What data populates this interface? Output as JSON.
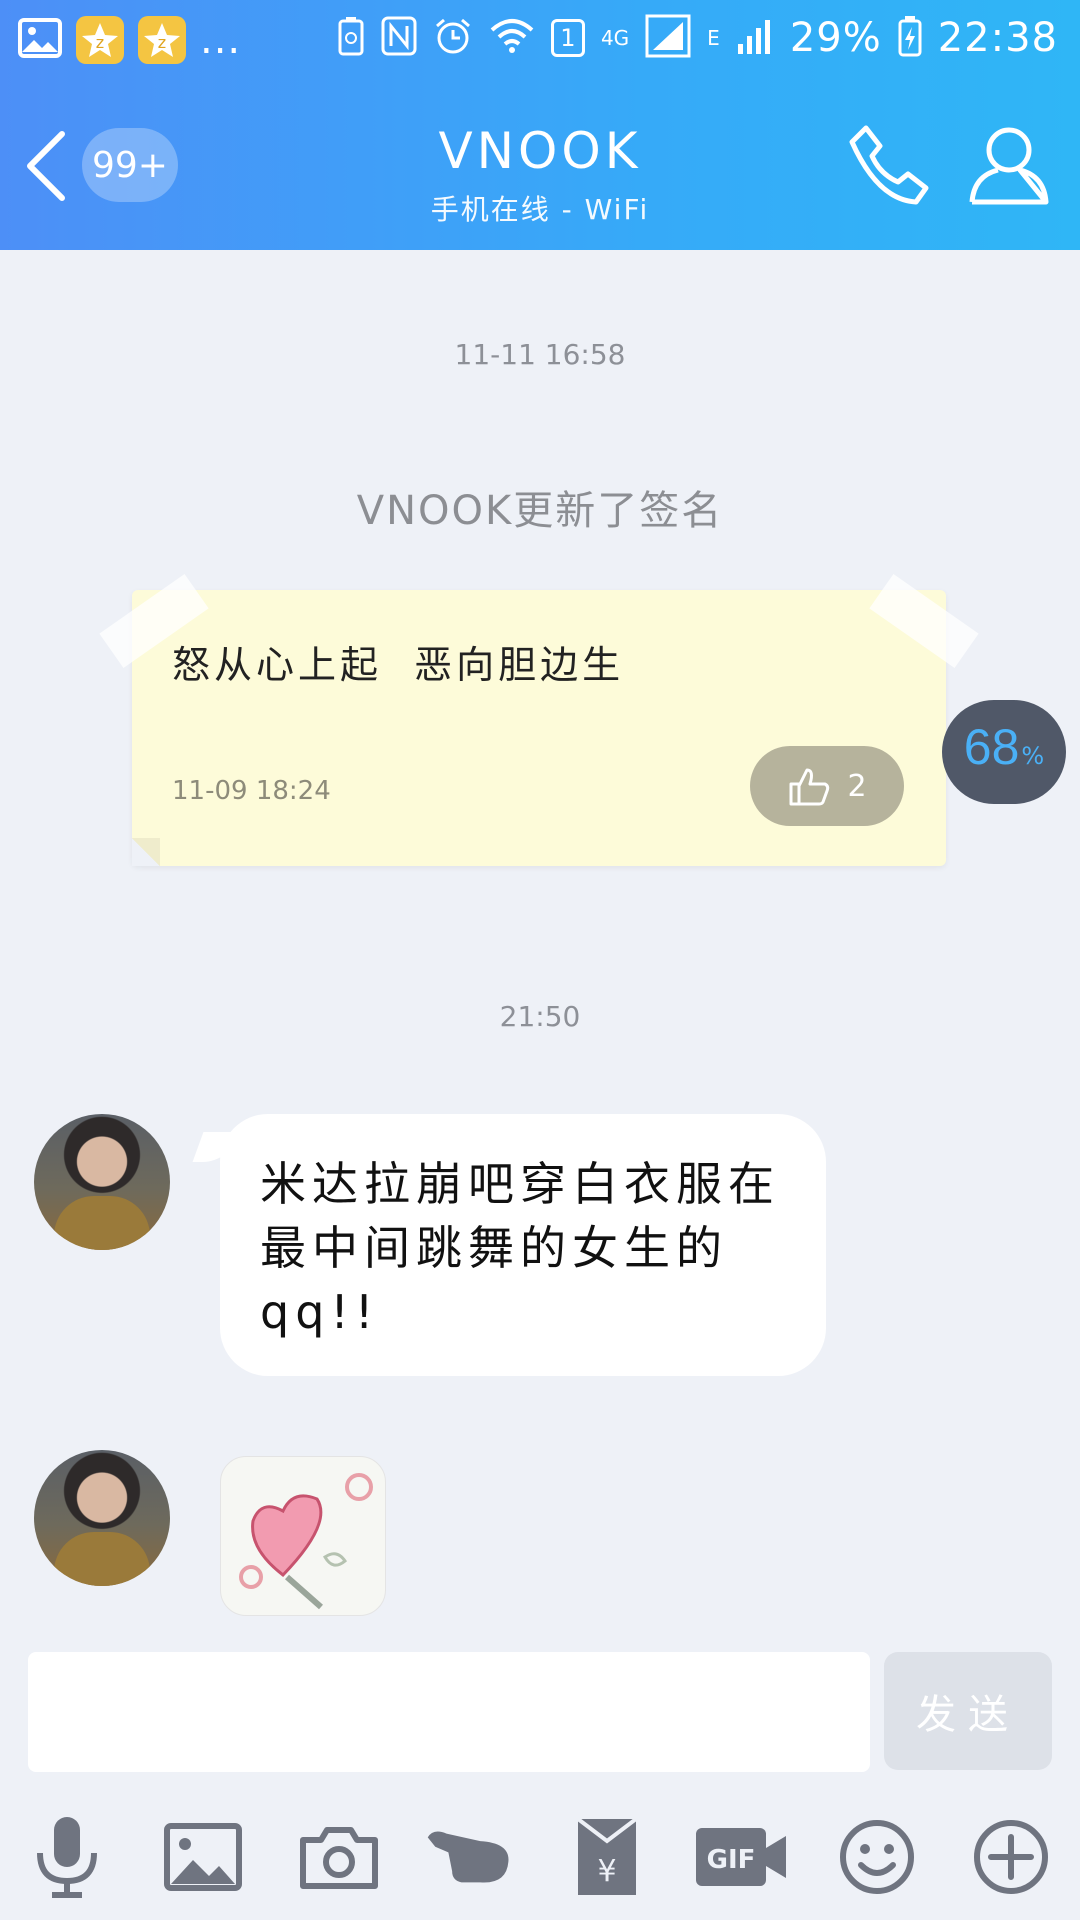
{
  "status_bar": {
    "more_indicator": "...",
    "sim_badge": "1",
    "network_4g": "4G",
    "network_e": "E",
    "battery": "29%",
    "time": "22:38"
  },
  "header": {
    "unread_badge": "99+",
    "title": "VNOOK",
    "subtitle": "手机在线 - WiFi"
  },
  "chat": {
    "timestamp_1": "11-11 16:58",
    "system_note": "VNOOK更新了签名",
    "signature": {
      "text": "怒从心上起  恶向胆边生",
      "date": "11-09 18:24",
      "likes": "2"
    },
    "percent_badge": {
      "value": "68",
      "unit": "%"
    },
    "timestamp_2": "21:50",
    "message_text": "米达拉崩吧穿白衣服在最中间跳舞的女生的qq!!"
  },
  "input": {
    "placeholder": "",
    "send_label": "发送"
  },
  "colors": {
    "header_start": "#4d8ff7",
    "header_end": "#2fb6f6",
    "background": "#eef1f7",
    "signature_card": "#fdfbd9",
    "toolbar_icon": "#6f7480",
    "percent_text": "#4ab0f6"
  },
  "toolbar_icons": [
    "microphone-icon",
    "image-icon",
    "camera-icon",
    "poke-hand-icon",
    "red-packet-icon",
    "gif-icon",
    "emoji-icon",
    "plus-icon"
  ]
}
